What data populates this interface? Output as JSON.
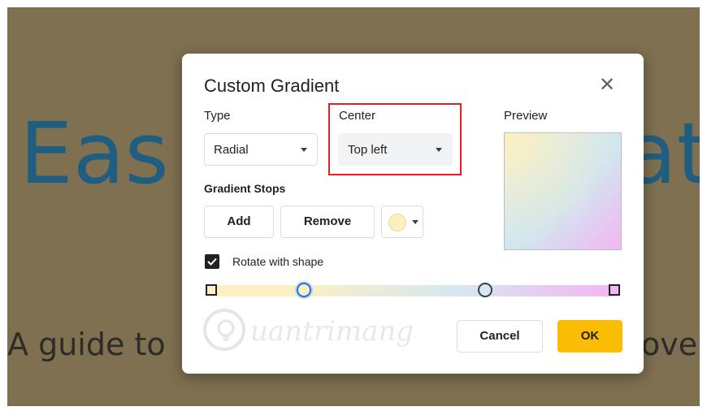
{
  "background": {
    "title_left": "Eas",
    "title_right": "at",
    "subtitle_left": "A guide to",
    "subtitle_right": "ove i"
  },
  "dialog": {
    "title": "Custom Gradient",
    "close_icon": "close-icon",
    "type_label": "Type",
    "type_value": "Radial",
    "center_label": "Center",
    "center_value": "Top left",
    "preview_label": "Preview",
    "stops_label": "Gradient Stops",
    "add_label": "Add",
    "remove_label": "Remove",
    "selected_stop_color": "#fdf0c0",
    "rotate_label": "Rotate with shape",
    "rotate_checked": true,
    "cancel_label": "Cancel",
    "ok_label": "OK",
    "watermark_text": "uantrimang",
    "colors": {
      "accent": "#fbbc04",
      "highlight_box": "#e0202a",
      "gradient_start": "#fdf0c0",
      "gradient_end": "#f4b6f2"
    }
  }
}
